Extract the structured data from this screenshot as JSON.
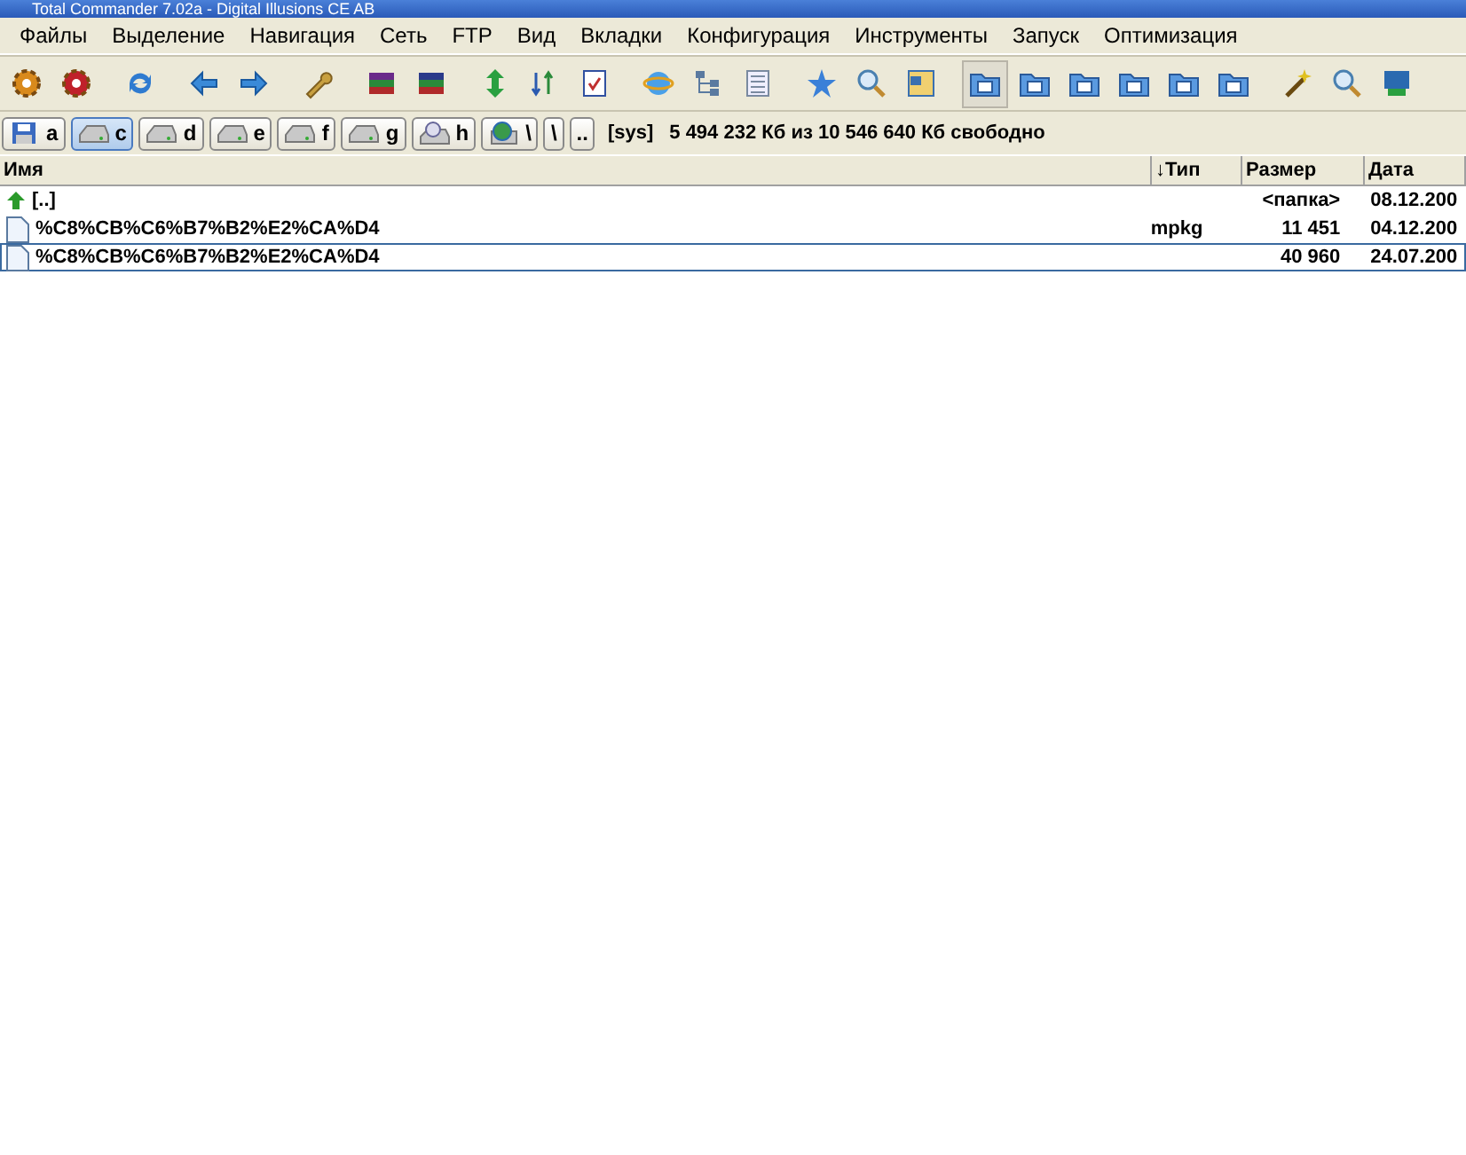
{
  "window": {
    "title": "Total Commander 7.02a - Digital Illusions CE AB"
  },
  "menu": [
    "Файлы",
    "Выделение",
    "Навигация",
    "Сеть",
    "FTP",
    "Вид",
    "Вкладки",
    "Конфигурация",
    "Инструменты",
    "Запуск",
    "Оптимизация"
  ],
  "toolbar": [
    {
      "pressed": false
    },
    {
      "pressed": false
    },
    {
      "pressed": false
    },
    {
      "pressed": false
    },
    {
      "pressed": false
    },
    {
      "pressed": false
    },
    {
      "pressed": false
    },
    {
      "pressed": false
    },
    {
      "pressed": false
    },
    {
      "pressed": false
    },
    {
      "pressed": false
    },
    {
      "pressed": false
    },
    {
      "pressed": false
    },
    {
      "pressed": false
    },
    {
      "pressed": false
    },
    {
      "pressed": false
    },
    {
      "pressed": false
    },
    {
      "pressed": true
    },
    {
      "pressed": false
    },
    {
      "pressed": false
    },
    {
      "pressed": false
    },
    {
      "pressed": false
    },
    {
      "pressed": false
    },
    {
      "pressed": false
    },
    {
      "pressed": false
    },
    {
      "pressed": false
    }
  ],
  "drives": [
    {
      "label": "a",
      "kind": "floppy",
      "selected": false
    },
    {
      "label": "c",
      "kind": "disk",
      "selected": true
    },
    {
      "label": "d",
      "kind": "disk",
      "selected": false
    },
    {
      "label": "e",
      "kind": "disk",
      "selected": false
    },
    {
      "label": "f",
      "kind": "disk",
      "selected": false
    },
    {
      "label": "g",
      "kind": "disk",
      "selected": false
    },
    {
      "label": "h",
      "kind": "cdrom",
      "selected": false
    },
    {
      "label": "\\",
      "kind": "network",
      "selected": false
    }
  ],
  "root_button": "\\",
  "up_button": "..",
  "volume_label": "[sys]",
  "free_space": "5 494 232 Кб из 10 546 640 Кб свободно",
  "table": {
    "columns": [
      "Имя",
      "↓Тип",
      "Размер",
      "Дата"
    ],
    "rows": [
      {
        "kind": "parent",
        "name": "[..]",
        "type": "",
        "size": "<папка>",
        "date": "08.12.200",
        "focused": false
      },
      {
        "kind": "file",
        "name": "%C8%CB%C6%B7%B2%E2%CA%D4",
        "type": "mpkg",
        "size": "11 451",
        "date": "04.12.200",
        "focused": false
      },
      {
        "kind": "file",
        "name": "%C8%CB%C6%B7%B2%E2%CA%D4",
        "type": "",
        "size": "40 960",
        "date": "24.07.200",
        "focused": true
      }
    ]
  }
}
